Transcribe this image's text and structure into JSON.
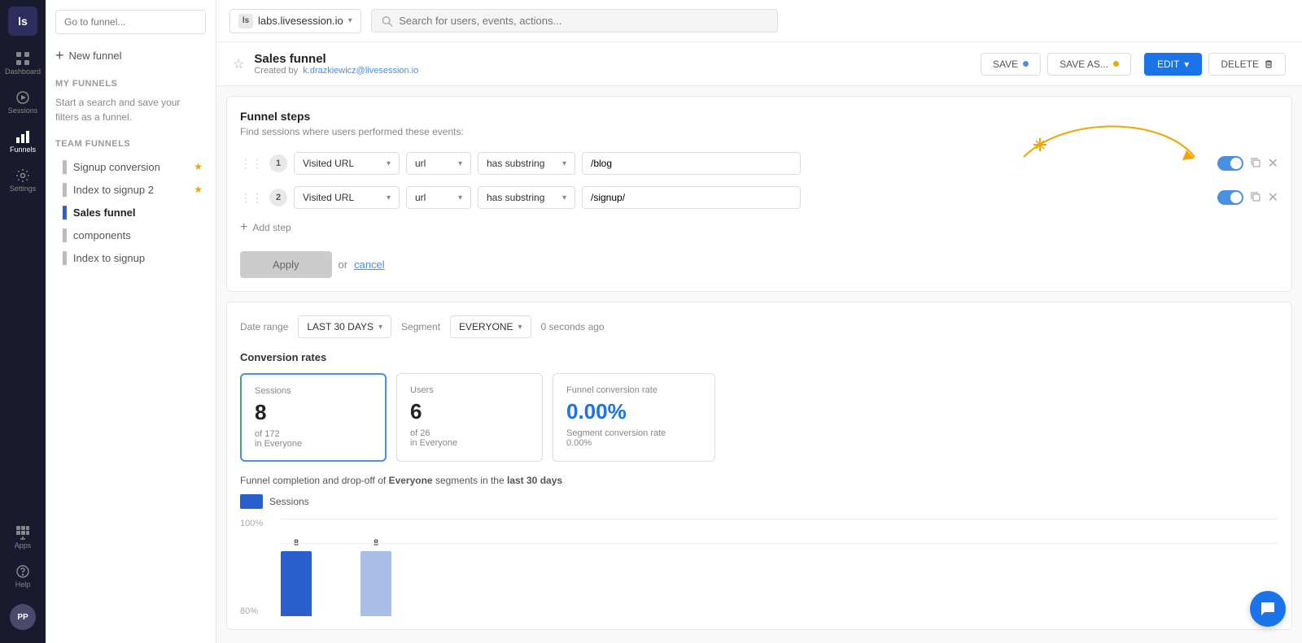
{
  "app": {
    "logo": "ls",
    "workspace": "labs.livesession.io"
  },
  "nav": {
    "items": [
      {
        "id": "dashboard",
        "label": "Dashboard",
        "icon": "grid"
      },
      {
        "id": "sessions",
        "label": "Sessions",
        "icon": "play"
      },
      {
        "id": "funnels",
        "label": "Funnels",
        "icon": "bar-chart",
        "active": true
      },
      {
        "id": "settings",
        "label": "Settings",
        "icon": "gear"
      }
    ],
    "bottom_items": [
      {
        "id": "apps",
        "label": "Apps",
        "icon": "grid-plus"
      },
      {
        "id": "help",
        "label": "Help",
        "icon": "question"
      }
    ]
  },
  "sidebar": {
    "search_placeholder": "Go to funnel...",
    "new_funnel_label": "New funnel",
    "my_funnels_title": "MY FUNNELS",
    "my_funnels_empty": "Start a search and save your filters as a funnel.",
    "team_funnels_title": "TEAM FUNNELS",
    "team_funnels": [
      {
        "id": 1,
        "name": "Signup conversion",
        "starred": true
      },
      {
        "id": 2,
        "name": "Index to signup 2",
        "starred": true
      },
      {
        "id": 3,
        "name": "Sales funnel",
        "starred": false,
        "active": true
      },
      {
        "id": 4,
        "name": "components",
        "starred": false
      },
      {
        "id": 5,
        "name": "Index to signup",
        "starred": false
      }
    ]
  },
  "funnel_header": {
    "title": "Sales funnel",
    "subtitle": "Created by",
    "author": "k.drazkiewicz@livesession.io",
    "save_label": "SAVE",
    "save_as_label": "SAVE AS...",
    "edit_label": "EDIT",
    "delete_label": "DELETE"
  },
  "funnel_steps": {
    "section_title": "Funnel steps",
    "section_desc": "Find sessions where users performed these events:",
    "steps": [
      {
        "num": 1,
        "type": "Visited URL",
        "attr": "url",
        "condition": "has substring",
        "value": "/blog"
      },
      {
        "num": 2,
        "type": "Visited URL",
        "attr": "url",
        "condition": "has substring",
        "value": "/signup/"
      }
    ],
    "add_step_label": "Add step",
    "apply_label": "Apply",
    "or_text": "or",
    "cancel_label": "cancel"
  },
  "analytics": {
    "date_range_label": "Date range",
    "segment_label": "Segment",
    "date_range_value": "LAST 30 DAYS",
    "segment_value": "EVERYONE",
    "timestamp": "0 seconds ago",
    "conversion_rates_title": "Conversion rates",
    "cards": [
      {
        "title": "Sessions",
        "value": "8",
        "sub1": "of 172",
        "sub2": "in Everyone",
        "active": true
      },
      {
        "title": "Users",
        "value": "6",
        "sub1": "of 26",
        "sub2": "in Everyone",
        "active": false
      },
      {
        "title": "Funnel conversion rate",
        "value": "0.00%",
        "sub1": "Segment conversion rate",
        "sub2": "0.00%",
        "active": false,
        "blue": true
      }
    ],
    "completion_title_pre": "Funnel completion and drop-off of",
    "completion_bold1": "Everyone",
    "completion_title_mid": "segments in the",
    "completion_bold2": "last 30 days",
    "legend_label": "Sessions",
    "chart": {
      "y_labels": [
        "100%",
        "80%"
      ],
      "bars": [
        {
          "label": "8",
          "height": 100,
          "color": "#2b5fce",
          "step": 1
        },
        {
          "label": "8",
          "height": 100,
          "color": "#a8bde8",
          "step": 2
        }
      ]
    }
  }
}
